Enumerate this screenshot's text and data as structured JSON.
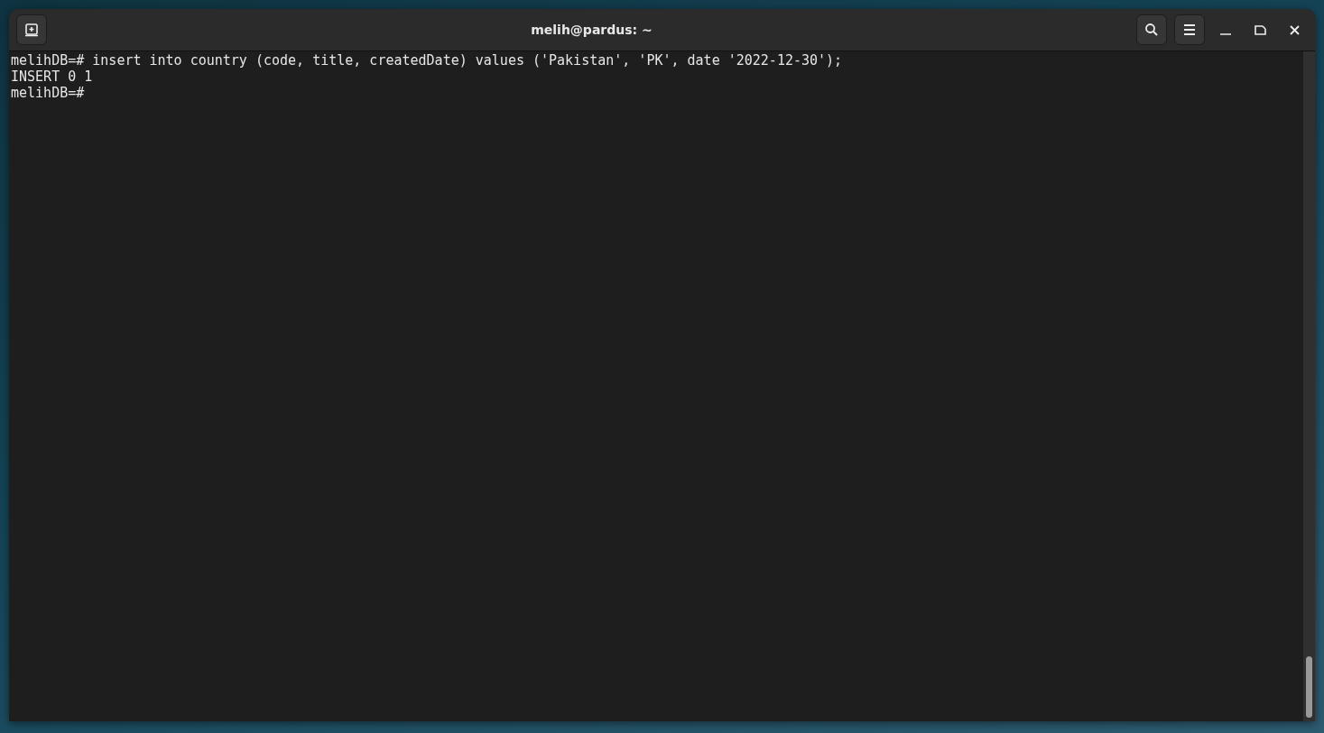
{
  "window": {
    "title": "melih@pardus: ~"
  },
  "terminal": {
    "lines": [
      "melihDB=# insert into country (code, title, createdDate) values ('Pakistan', 'PK', date '2022-12-30');",
      "INSERT 0 1",
      "melihDB=#"
    ]
  }
}
